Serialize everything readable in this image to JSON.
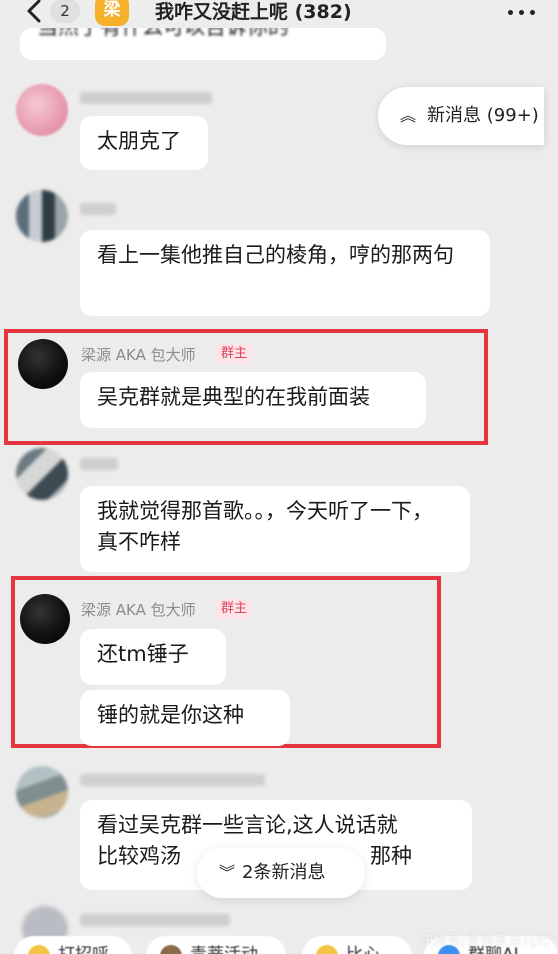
{
  "header": {
    "unread_count": "2",
    "group_avatar_char": "梁",
    "title": "我咋又没赶上呢 (382)"
  },
  "floating": {
    "new_messages": "新消息 (99+)",
    "new_messages_bottom": "2条新消息"
  },
  "messages": [
    {
      "text_cut": "当然了有什么可以告诉你的"
    },
    {
      "text": "太朋克了"
    },
    {
      "text": "看上一集他推自己的棱角，哼的那两句"
    },
    {
      "sender": "梁源 AKA 包大师",
      "role": "群主",
      "text": "吴克群就是典型的在我前面装"
    },
    {
      "text": "我就觉得那首歌。。，今天听了一下，真不咋样"
    },
    {
      "sender": "梁源 AKA 包大师",
      "role": "群主",
      "texts": [
        "还tm锤子",
        "锤的就是你这种"
      ]
    },
    {
      "text_line1": "看过吴克群一些言论,这人说话就",
      "text_line2_a": "比较鸡汤",
      "text_line2_b": "那种"
    }
  ],
  "quick_bar": [
    "打招呼",
    "青蒂活动",
    "比心",
    "群聊AI"
  ],
  "watermark": "快传号/青蒂有点儿忙"
}
